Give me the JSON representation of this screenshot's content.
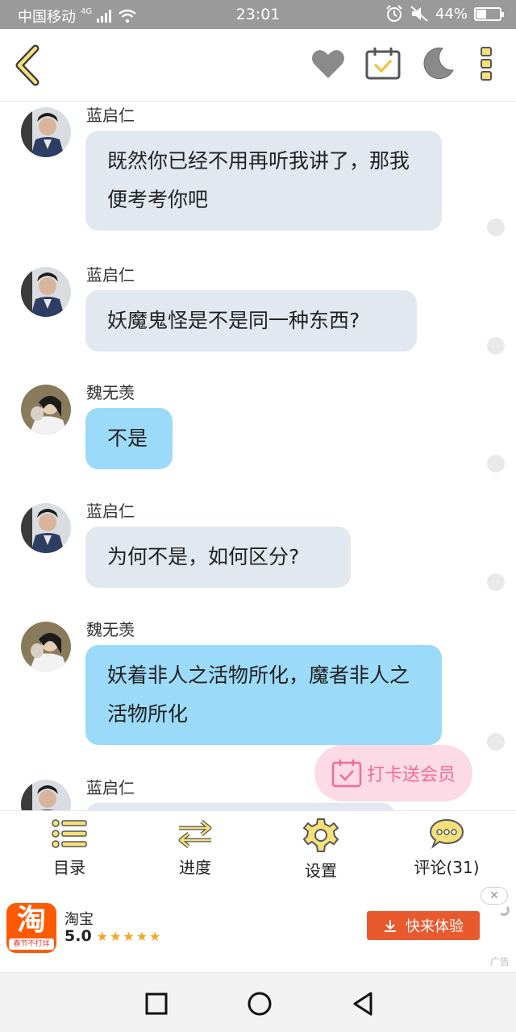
{
  "status_bar": {
    "carrier": "中国移动",
    "network": "4G",
    "time": "23:01",
    "battery": "44%",
    "battery_level": 0.44
  },
  "header": {
    "icons": [
      "back-icon",
      "heart-icon",
      "calendar-check-icon",
      "moon-icon",
      "more-icon"
    ]
  },
  "messages": [
    {
      "sender": "蓝启仁",
      "text": "既然你已经不用再听我讲了，那我便考考你吧",
      "style": "gray"
    },
    {
      "sender": "蓝启仁",
      "text": "妖魔鬼怪是不是同一种东西?",
      "style": "gray"
    },
    {
      "sender": "魏无羡",
      "text": "不是",
      "style": "blue"
    },
    {
      "sender": "蓝启仁",
      "text": "为何不是，如何区分?",
      "style": "gray"
    },
    {
      "sender": "魏无羡",
      "text": "妖着非人之活物所化，魔者非人之活物所化",
      "style": "blue"
    },
    {
      "sender": "蓝启仁",
      "text": "",
      "style": "gray"
    }
  ],
  "checkin_button": {
    "label": "打卡送会员"
  },
  "toolbar": {
    "catalog": "目录",
    "progress": "进度",
    "settings": "设置",
    "comments": "评论(31)"
  },
  "ad": {
    "logo_text": "淘",
    "logo_sub": "春节不打烊",
    "app_name": "淘宝",
    "rating": "5.0",
    "cta": "快来体验",
    "tag": "广告",
    "colors": {
      "brand": "#ff5a00",
      "cta": "#e85a2e"
    }
  },
  "colors": {
    "accent": "#e8c84a",
    "bubble_gray": "#e2e8f0",
    "bubble_blue": "#9bdaf8"
  }
}
